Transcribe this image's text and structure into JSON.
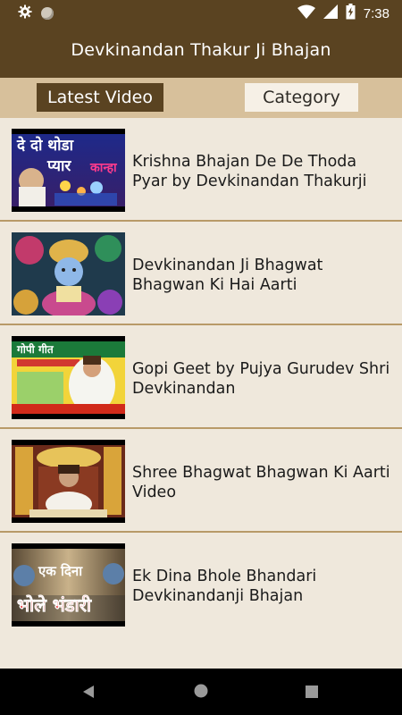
{
  "status_bar": {
    "time": "7:38",
    "icons": [
      "gear-icon",
      "circle-icon",
      "wifi-icon",
      "signal-icon",
      "battery-charging-icon"
    ]
  },
  "app_bar": {
    "title": "Devkinandan Thakur Ji Bhajan"
  },
  "tabs": [
    {
      "label": "Latest Video",
      "selected": true
    },
    {
      "label": "Category",
      "selected": false
    }
  ],
  "videos": [
    {
      "title": "Krishna Bhajan De De Thoda Pyar by Devkinandan Thakurji",
      "thumb_text": [
        "दे दो थोडा",
        "प्यार",
        "कान्हा"
      ]
    },
    {
      "title": "Devkinandan Ji Bhagwat Bhagwan Ki Hai Aarti"
    },
    {
      "title": "Gopi Geet by Pujya Gurudev Shri Devkinandan",
      "thumb_text": [
        "गोपी गीत"
      ]
    },
    {
      "title": "Shree Bhagwat Bhagwan Ki Aarti Video"
    },
    {
      "title": "Ek Dina Bhole Bhandari Devkinandanji Bhajan",
      "thumb_text": [
        "एक दिना",
        "भोले भंडारी"
      ]
    }
  ],
  "nav_bar": {
    "buttons": [
      "back-icon",
      "home-icon",
      "recents-icon"
    ]
  },
  "colors": {
    "primary": "#5a4321",
    "tab_bar": "#d7c09b",
    "background": "#efe8dc",
    "divider": "#b89a68"
  }
}
